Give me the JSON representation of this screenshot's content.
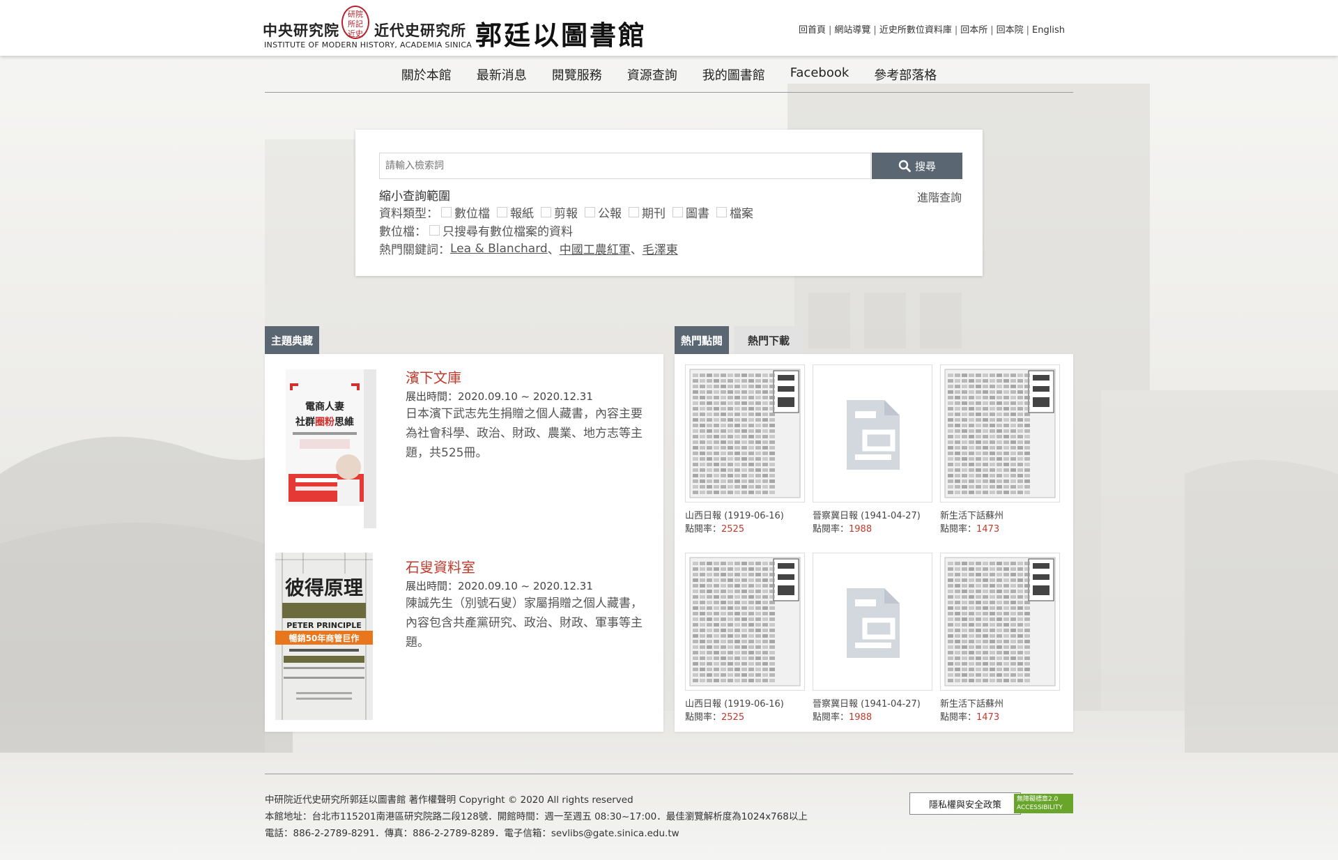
{
  "header": {
    "institute_zh_1": "中央研究院",
    "seal_text": "研院 所記 近史",
    "institute_zh_2": "近代史研究所",
    "institute_en": "INSTITUTE OF MODERN HISTORY, ACADEMIA SINICA",
    "library_name": "郭廷以圖書館",
    "top_links": [
      "回首頁",
      "網站導覽",
      "近史所數位資料庫",
      "回本所",
      "回本院",
      "English"
    ],
    "separator": "|"
  },
  "nav": {
    "items": [
      "關於本館",
      "最新消息",
      "閱覽服務",
      "資源查詢",
      "我的圖書館",
      "Facebook",
      "參考部落格"
    ]
  },
  "search": {
    "placeholder": "請輸入檢索詞",
    "button_label": "搜尋",
    "filter_title": "縮小查詢範圍",
    "advanced_label": "進階查詢",
    "type_label": "資料類型：",
    "types": [
      "數位檔",
      "報紙",
      "剪報",
      "公報",
      "期刊",
      "圖書",
      "檔案"
    ],
    "digital_label": "數位檔：",
    "digital_option": "只搜尋有數位檔案的資料",
    "hot_label": "熱門關鍵詞：",
    "hot_keywords": [
      "Lea & Blanchard",
      "中國工農紅軍",
      "毛澤東"
    ],
    "hot_sep": "、"
  },
  "collections": {
    "tab_label": "主題典藏",
    "items": [
      {
        "title": "濱下文庫",
        "period": "展出時間：2020.09.10 ~ 2020.12.31",
        "description": "日本濱下武志先生捐贈之個人藏書，內容主要為社會科學、政治、財政、農業、地方志等主題，共525冊。",
        "cover_title": "電商人妻 社群圈粉思維"
      },
      {
        "title": "石叟資料室",
        "period": "展出時間：2020.09.10 ~ 2020.12.31",
        "description": "陳誠先生（別號石叟）家屬捐贈之個人藏書，內容包含共產黨研究、政治、財政、軍事等主題。",
        "cover_title": "彼得原理",
        "cover_en": "PETER PRINCIPLE",
        "cover_band": "暢銷50年商管巨作"
      }
    ]
  },
  "popular": {
    "tab_views": "熱門點閱",
    "tab_downloads": "熱門下載",
    "count_label": "點閱率：",
    "items": [
      {
        "title": "山西日報 (1919-06-16)",
        "count": "2525",
        "kind": "newspaper"
      },
      {
        "title": "晉察冀日報 (1941-04-27)",
        "count": "1988",
        "kind": "document-icon"
      },
      {
        "title": "新生活下話蘇州",
        "count": "1473",
        "kind": "newspaper"
      },
      {
        "title": "山西日報 (1919-06-16)",
        "count": "2525",
        "kind": "newspaper"
      },
      {
        "title": "晉察冀日報 (1941-04-27)",
        "count": "1988",
        "kind": "document-icon"
      },
      {
        "title": "新生活下話蘇州",
        "count": "1473",
        "kind": "newspaper"
      }
    ]
  },
  "footer": {
    "line1": "中研院近代史研究所郭廷以圖書館 著作權聲明 Copyright © 2020 All rights reserved",
    "line2": "本館地址：台北市115201南港區研究院路二段128號．開館時間：週一至週五 08:30~17:00．最佳瀏覽解析度為1024x768以上",
    "line3": "電話：886-2-2789-8291．傳真：886-2-2789-8289．電子信箱：sevlibs@gate.sinica.edu.tw",
    "privacy_label": "隱私權與安全政策",
    "badge_label": "無障礙標章2.0 ACCESSIBILITY"
  },
  "colors": {
    "tab_active": "#5b6673",
    "accent_red": "#c0392b"
  }
}
